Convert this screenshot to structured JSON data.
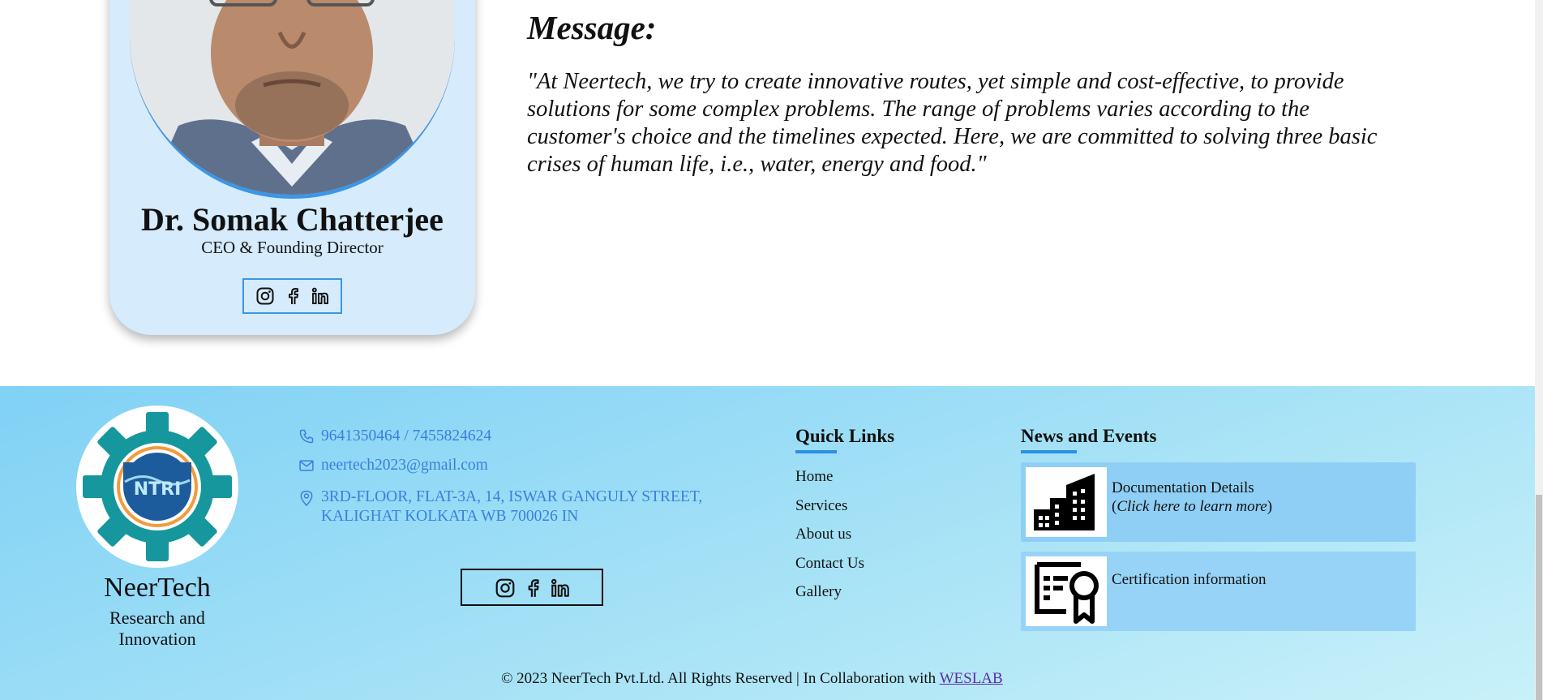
{
  "profile": {
    "name": "Dr. Somak Chatterjee",
    "role": "CEO & Founding Director",
    "social": [
      "instagram-icon",
      "facebook-icon",
      "linkedin-icon"
    ]
  },
  "message": {
    "title": "Message:",
    "text": "\"At Neertech, we try to create innovative routes, yet simple and cost-effective, to provide solutions for some complex problems. The range of problems varies according to the customer's choice and the timelines expected. Here, we are committed to solving three basic crises of human life, i.e., water, energy and food.\""
  },
  "footer": {
    "logo_text": "NTRI",
    "brand_name": "NeerTech",
    "brand_sub": "Research and Innovation",
    "contact": {
      "phone": "9641350464 / 7455824624",
      "email": "neertech2023@gmail.com",
      "address": "3RD-FLOOR, FLAT-3A, 14, ISWAR GANGULY STREET, KALIGHAT KOLKATA WB 700026 IN"
    },
    "quick_links": {
      "heading": "Quick Links",
      "items": [
        "Home",
        "Services",
        "About us",
        "Contact Us",
        "Gallery"
      ]
    },
    "news": {
      "heading": "News and Events",
      "items": [
        {
          "title": "Documentation Details",
          "sub": "Click here to learn more",
          "icon": "building-icon"
        },
        {
          "title": "Certification information",
          "icon": "certificate-icon"
        }
      ]
    },
    "copyright": "© 2023 NeerTech Pvt.Ltd. All Rights Reserved | In Collaboration with",
    "copyright_link": "WESLAB"
  },
  "colors": {
    "accent_blue": "#3a97e8",
    "link_blue": "#3a7fdc",
    "footer_bg": "#80d1f5",
    "card_bg": "#d6ebfb",
    "link_purple": "#5b2ea8"
  }
}
